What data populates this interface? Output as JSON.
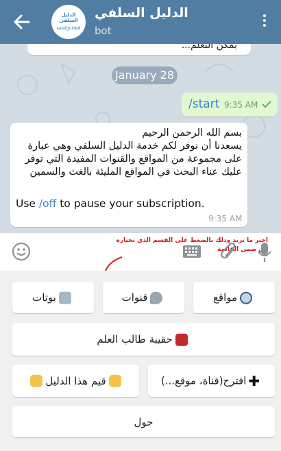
{
  "header": {
    "title": "الدليل السلفي",
    "subtitle": "bot",
    "avatar_text": "الدليل السلفي",
    "avatar_subtext": "salafguide8"
  },
  "chat": {
    "previous_message_fragment": "يمكن التعلم...",
    "date_label": "January 28",
    "outgoing": {
      "text": "/start",
      "time": "9:35 AM"
    },
    "incoming": {
      "arabic_lines": [
        "بسم الله الرحمن الرحيم",
        "يسعدنا أن نوفر لكم خدمة الدليل السلفي وهي عبارة",
        "على مجموعة من المواقع والقنوات المفيدة التي توفر",
        "عليك عناء البحث في المواقع المليئة بالغث والسمين"
      ],
      "english_prefix": "Use ",
      "english_link": "/off",
      "english_suffix": " to pause your subscription.",
      "time": "9:35 AM"
    }
  },
  "input_bar": {
    "hint_line1": "اختر ما تريد وذلك بالضغط على القسم الذي تختاره",
    "hint_line2": "من ضمن القائمة"
  },
  "keyboard": {
    "row1": [
      {
        "label": "مواقع",
        "icon": "globe-icon"
      },
      {
        "label": "قنوات",
        "icon": "satellite-dish-icon"
      },
      {
        "label": "بوتات",
        "icon": "robot-icon"
      }
    ],
    "row2": [
      {
        "label": "حقيبة طالب العلم",
        "icon": "backpack-icon"
      }
    ],
    "row3": [
      {
        "label": "اقترح(قناة، موقع...)",
        "icon": "plus-icon"
      },
      {
        "label": "قيم هذا الدليل",
        "icon": "thumbs-icon"
      }
    ],
    "row4": [
      {
        "label": "حول"
      }
    ]
  },
  "colors": {
    "header": "#527da3",
    "outgoing_bubble": "#e2f8d3",
    "link": "#3883c7",
    "hint": "#d01f1f"
  }
}
